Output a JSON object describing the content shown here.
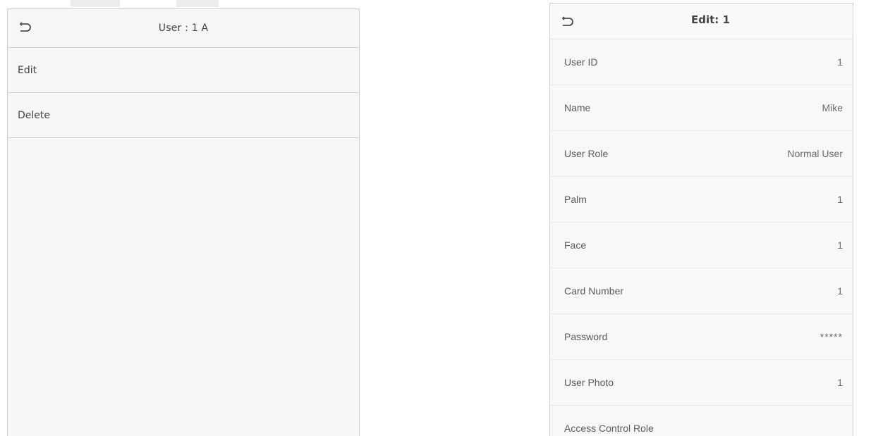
{
  "left_screen": {
    "title": "User : 1 A",
    "back_icon": "return-arrow-icon",
    "menu": [
      {
        "label": "Edit"
      },
      {
        "label": "Delete"
      }
    ]
  },
  "right_screen": {
    "title": "Edit: 1",
    "back_icon": "return-arrow-icon",
    "fields": [
      {
        "label": "User ID",
        "value": "1"
      },
      {
        "label": "Name",
        "value": "Mike"
      },
      {
        "label": "User Role",
        "value": "Normal User"
      },
      {
        "label": "Palm",
        "value": "1"
      },
      {
        "label": "Face",
        "value": "1"
      },
      {
        "label": "Card Number",
        "value": "1"
      },
      {
        "label": "Password",
        "value": "*****"
      },
      {
        "label": "User Photo",
        "value": "1"
      },
      {
        "label": "Access Control Role",
        "value": ""
      }
    ]
  }
}
